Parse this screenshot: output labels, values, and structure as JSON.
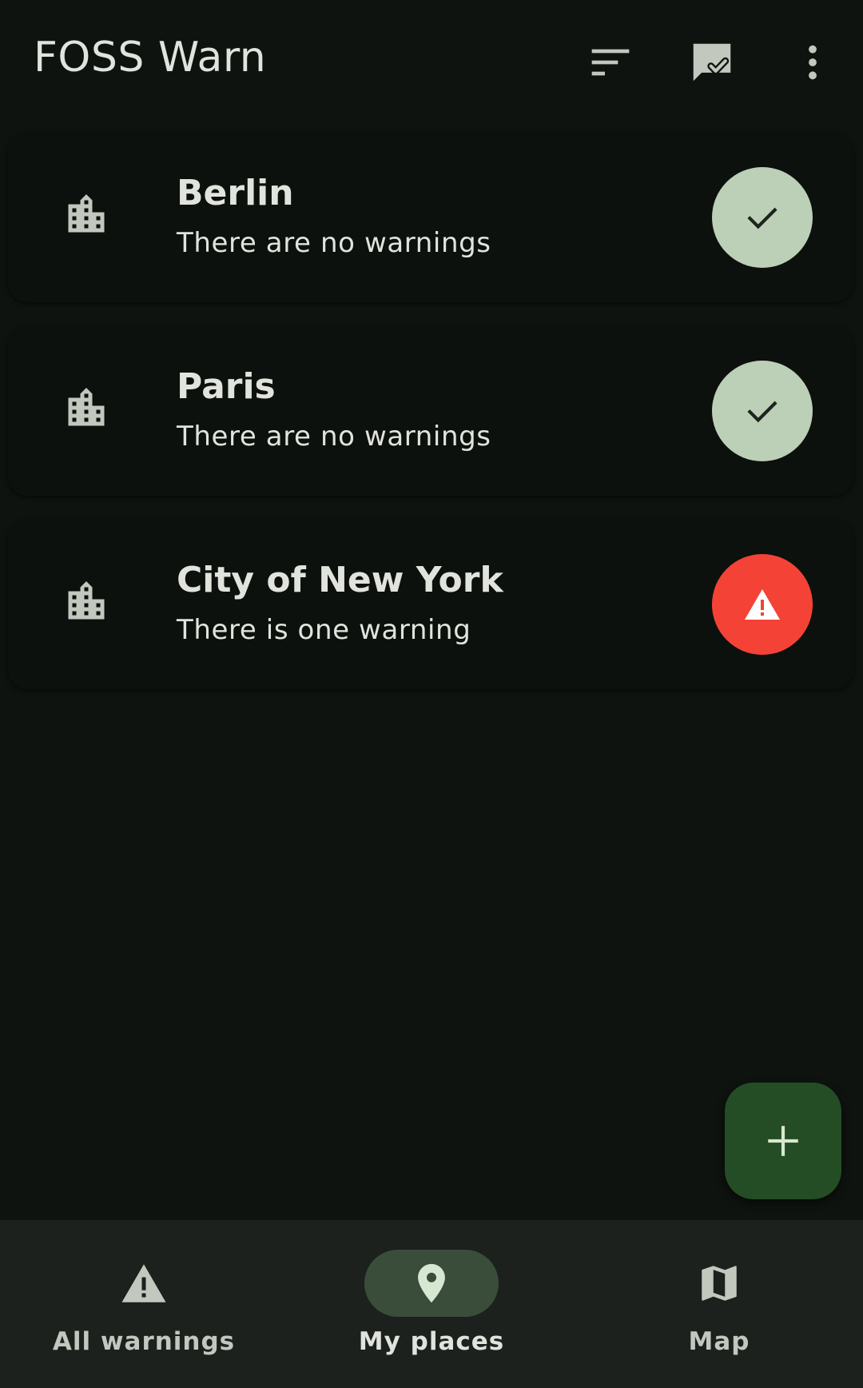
{
  "app": {
    "title": "FOSS Warn",
    "colors": {
      "background": "#0e130f",
      "ok_status": "#bccfb7",
      "warning_status": "#f44336",
      "fab": "#244d25",
      "nav_active_pill": "#3a4d3a"
    }
  },
  "toolbar": {
    "icons": [
      "sort-icon",
      "mark-all-read-icon",
      "more-vert-icon"
    ]
  },
  "places": [
    {
      "name": "Berlin",
      "status_text": "There are no warnings",
      "status": "ok",
      "icon": "city-icon"
    },
    {
      "name": "Paris",
      "status_text": "There are no warnings",
      "status": "ok",
      "icon": "city-icon"
    },
    {
      "name": "City of New York",
      "status_text": "There is one warning",
      "status": "warning",
      "icon": "city-icon"
    }
  ],
  "fab": {
    "icon": "plus-icon"
  },
  "bottom_nav": {
    "items": [
      {
        "label": "All warnings",
        "icon": "warning-icon",
        "active": false
      },
      {
        "label": "My places",
        "icon": "location-pin-icon",
        "active": true
      },
      {
        "label": "Map",
        "icon": "map-icon",
        "active": false
      }
    ]
  }
}
